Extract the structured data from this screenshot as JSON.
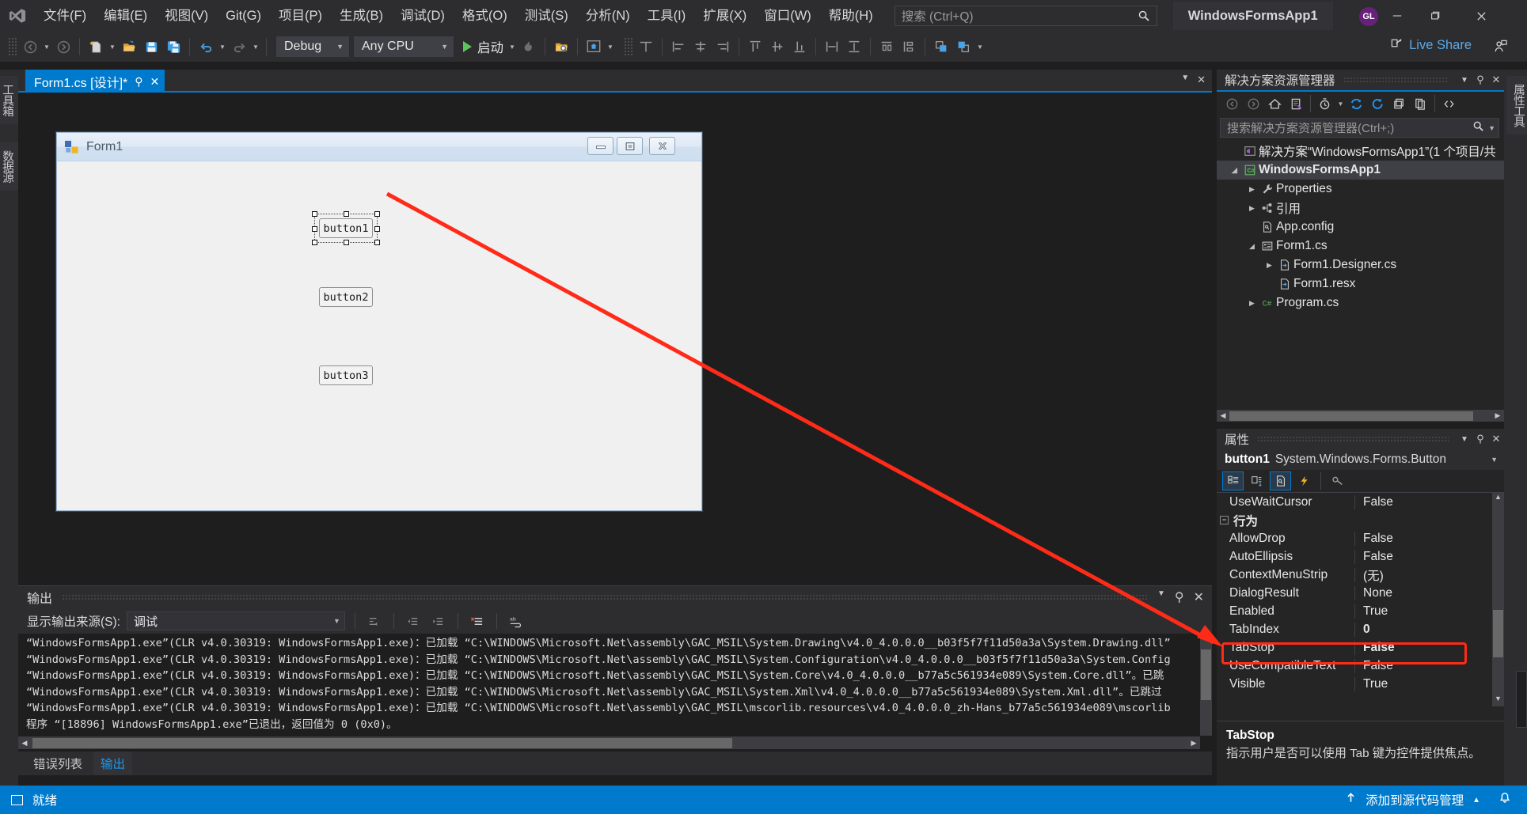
{
  "titlebar": {
    "logo_icon": "visual-studio-logo",
    "menus": [
      "文件(F)",
      "编辑(E)",
      "视图(V)",
      "Git(G)",
      "项目(P)",
      "生成(B)",
      "调试(D)",
      "格式(O)",
      "测试(S)",
      "分析(N)",
      "工具(I)",
      "扩展(X)",
      "窗口(W)",
      "帮助(H)"
    ],
    "search_placeholder": "搜索 (Ctrl+Q)",
    "search_icon": "search-icon",
    "project_name": "WindowsFormsApp1",
    "account_initials": "GL",
    "window_controls": {
      "minimize": "–",
      "restore": "❐",
      "close": "✕"
    }
  },
  "toolbar": {
    "nav_back_icon": "back-arrow-icon",
    "nav_forward_icon": "forward-arrow-icon",
    "new_icon": "new-file-icon",
    "open_icon": "open-folder-icon",
    "save_icon": "save-icon",
    "save_all_icon": "save-all-icon",
    "undo_icon": "undo-icon",
    "redo_icon": "redo-icon",
    "config_value": "Debug",
    "platform_value": "Any CPU",
    "start_label": "启动",
    "start_icon": "play-icon",
    "hot_reload_icon": "hot-reload-icon",
    "find_in_files_icon": "find-in-files-icon",
    "preview_icon": "preview-icon",
    "align_icons": [
      "align-lefts-icon",
      "align-centers-icon",
      "align-rights-icon",
      "align-tops-icon",
      "align-middles-icon",
      "align-bottoms-icon",
      "make-same-width-icon",
      "make-same-height-icon",
      "horizontal-spacing-icon",
      "vertical-spacing-icon",
      "bring-to-front-icon",
      "send-to-back-icon"
    ],
    "live_share_label": "Live Share",
    "live_share_icon": "live-share-icon",
    "live_share_right_icon": "person-share-icon"
  },
  "left_rail": {
    "tabs": [
      "工具箱",
      "数据源"
    ]
  },
  "right_rail": {
    "tabs": [
      "属性工具"
    ]
  },
  "designer": {
    "tab_label": "Form1.cs [设计]*",
    "tab_pin_icon": "pin-icon",
    "tab_close_icon": "close-icon",
    "tabstrip_right_icons": [
      "chevron-down-icon",
      "close-icon"
    ],
    "form": {
      "title": "Form1",
      "icon": "form-icon",
      "minimize_icon": "minimize-icon",
      "maximize_icon": "maximize-icon",
      "close_icon": "close-icon",
      "buttons": [
        {
          "name": "button1",
          "text": "button1",
          "selected": true
        },
        {
          "name": "button2",
          "text": "button2",
          "selected": false
        },
        {
          "name": "button3",
          "text": "button3",
          "selected": false
        }
      ]
    },
    "annotation": {
      "color": "#ff2b18",
      "type": "arrow"
    }
  },
  "output": {
    "title": "输出",
    "header_icons": [
      "chevron-down-icon",
      "pin-icon",
      "close-icon"
    ],
    "source_label": "显示输出来源(S):",
    "source_value": "调试",
    "toolbar_icons": [
      "go-to-message-icon",
      "previous-message-icon",
      "next-message-icon",
      "clear-all-icon",
      "toggle-wordwrap-icon"
    ],
    "lines": [
      "“WindowsFormsApp1.exe”(CLR v4.0.30319: WindowsFormsApp1.exe)：已加载 “C:\\WINDOWS\\Microsoft.Net\\assembly\\GAC_MSIL\\System.Drawing\\v4.0_4.0.0.0__b03f5f7f11d50a3a\\System.Drawing.dll”",
      "“WindowsFormsApp1.exe”(CLR v4.0.30319: WindowsFormsApp1.exe)：已加载 “C:\\WINDOWS\\Microsoft.Net\\assembly\\GAC_MSIL\\System.Configuration\\v4.0_4.0.0.0__b03f5f7f11d50a3a\\System.Config",
      "“WindowsFormsApp1.exe”(CLR v4.0.30319: WindowsFormsApp1.exe)：已加载 “C:\\WINDOWS\\Microsoft.Net\\assembly\\GAC_MSIL\\System.Core\\v4.0_4.0.0.0__b77a5c561934e089\\System.Core.dll”。已跳",
      "“WindowsFormsApp1.exe”(CLR v4.0.30319: WindowsFormsApp1.exe)：已加载 “C:\\WINDOWS\\Microsoft.Net\\assembly\\GAC_MSIL\\System.Xml\\v4.0_4.0.0.0__b77a5c561934e089\\System.Xml.dll”。已跳过",
      "“WindowsFormsApp1.exe”(CLR v4.0.30319: WindowsFormsApp1.exe)：已加载 “C:\\WINDOWS\\Microsoft.Net\\assembly\\GAC_MSIL\\mscorlib.resources\\v4.0_4.0.0.0_zh-Hans_b77a5c561934e089\\mscorlib",
      "程序 “[18896] WindowsFormsApp1.exe”已退出，返回值为 0 (0x0)。"
    ],
    "bottom_tabs": [
      {
        "label": "错误列表",
        "active": false
      },
      {
        "label": "输出",
        "active": true
      }
    ]
  },
  "solution_explorer": {
    "title": "解决方案资源管理器",
    "header_icons": [
      "chevron-down-icon",
      "pin-icon",
      "close-icon"
    ],
    "toolbar_icons": [
      "back-arrow-icon",
      "forward-arrow-icon",
      "home-icon",
      "sync-with-active-document-icon",
      "pending-changes-filter-icon",
      "refresh-icon",
      "collapse-all-icon",
      "properties-window-icon",
      "copy-icon",
      "show-all-files-icon"
    ],
    "search_placeholder": "搜索解决方案资源管理器(Ctrl+;)",
    "search_icon": "search-icon",
    "tree": [
      {
        "label": "解决方案“WindowsFormsApp1”(1 个项目/共",
        "indent": 0,
        "expander": "none",
        "icon": "solution-icon",
        "selected": false,
        "bold": false
      },
      {
        "label": "WindowsFormsApp1",
        "indent": 1,
        "expander": "expanded",
        "icon": "csharp-project-icon",
        "selected": true,
        "bold": true
      },
      {
        "label": "Properties",
        "indent": 2,
        "expander": "collapsed",
        "icon": "properties-wrench-icon",
        "selected": false,
        "bold": false
      },
      {
        "label": "引用",
        "indent": 2,
        "expander": "collapsed",
        "icon": "references-icon",
        "selected": false,
        "bold": false
      },
      {
        "label": "App.config",
        "indent": 2,
        "expander": "none",
        "icon": "config-file-icon",
        "selected": false,
        "bold": false
      },
      {
        "label": "Form1.cs",
        "indent": 2,
        "expander": "expanded",
        "icon": "form-file-icon",
        "selected": false,
        "bold": false
      },
      {
        "label": "Form1.Designer.cs",
        "indent": 3,
        "expander": "collapsed",
        "icon": "code-file-icon",
        "selected": false,
        "bold": false
      },
      {
        "label": "Form1.resx",
        "indent": 3,
        "expander": "none",
        "icon": "code-file-icon",
        "selected": false,
        "bold": false
      },
      {
        "label": "Program.cs",
        "indent": 2,
        "expander": "collapsed",
        "icon": "csharp-file-icon",
        "selected": false,
        "bold": false
      }
    ]
  },
  "properties": {
    "title": "属性",
    "header_icons": [
      "chevron-down-icon",
      "pin-icon",
      "close-icon"
    ],
    "object_name": "button1",
    "object_type": "System.Windows.Forms.Button",
    "toolbar_icons": [
      "categorized-icon",
      "alphabetical-icon",
      "properties-page-icon",
      "events-icon",
      "property-pages-icon"
    ],
    "rows": [
      {
        "key": "UseWaitCursor",
        "value": "False",
        "category": false,
        "bold": false,
        "highlight": false
      },
      {
        "key": "行为",
        "value": "",
        "category": true,
        "bold": false,
        "highlight": false
      },
      {
        "key": "AllowDrop",
        "value": "False",
        "category": false,
        "bold": false,
        "highlight": false
      },
      {
        "key": "AutoEllipsis",
        "value": "False",
        "category": false,
        "bold": false,
        "highlight": false
      },
      {
        "key": "ContextMenuStrip",
        "value": "(无)",
        "category": false,
        "bold": false,
        "highlight": false
      },
      {
        "key": "DialogResult",
        "value": "None",
        "category": false,
        "bold": false,
        "highlight": false
      },
      {
        "key": "Enabled",
        "value": "True",
        "category": false,
        "bold": false,
        "highlight": false
      },
      {
        "key": "TabIndex",
        "value": "0",
        "category": false,
        "bold": true,
        "highlight": false
      },
      {
        "key": "TabStop",
        "value": "False",
        "category": false,
        "bold": true,
        "highlight": true
      },
      {
        "key": "UseCompatibleText",
        "value": "False",
        "category": false,
        "bold": false,
        "highlight": false
      },
      {
        "key": "Visible",
        "value": "True",
        "category": false,
        "bold": false,
        "highlight": false
      }
    ],
    "description_title": "TabStop",
    "description_text": "指示用户是否可以使用 Tab 键为控件提供焦点。",
    "highlight_color": "#ff2b18"
  },
  "statusbar": {
    "ready_label": "就绪",
    "ready_icon": "ready-icon",
    "source_control_label": "添加到源代码管理",
    "source_control_icon": "upload-arrow-icon",
    "chevron_icon": "chevron-up-icon",
    "notification_icon": "bell-icon",
    "accent_color": "#007acc"
  }
}
